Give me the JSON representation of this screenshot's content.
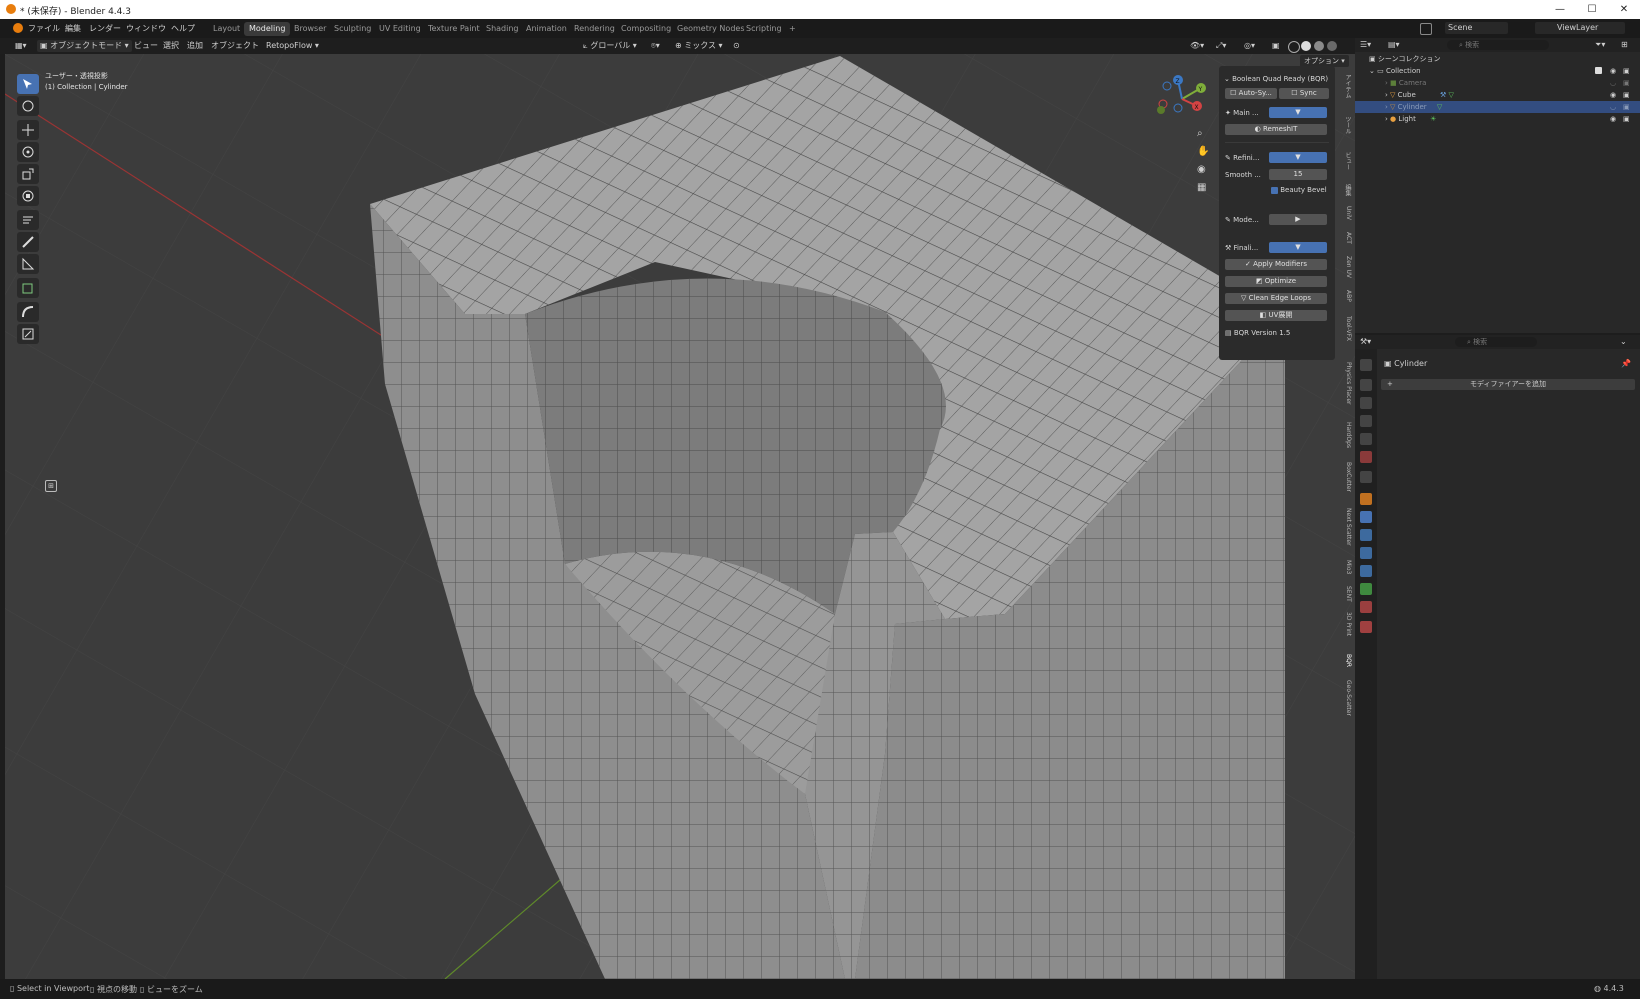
{
  "window": {
    "title": "* (未保存) - Blender 4.4.3",
    "minimize": "—",
    "maximize": "☐",
    "close": "✕"
  },
  "menu": [
    "ファイル",
    "編集",
    "レンダー",
    "ウィンドウ",
    "ヘルプ"
  ],
  "workspaces": [
    "Layout",
    "Modeling",
    "Browser",
    "Sculpting",
    "UV Editing",
    "Texture Paint",
    "Shading",
    "Animation",
    "Rendering",
    "Compositing",
    "Geometry Nodes",
    "Scripting",
    "+"
  ],
  "active_workspace": "Modeling",
  "header": {
    "mode": "オブジェクトモード",
    "view": "ビュー",
    "select": "選択",
    "add": "追加",
    "object": "オブジェクト",
    "addon": "RetopoFlow",
    "transform": "グローバル",
    "snap": "ミックス",
    "options": "オプション"
  },
  "viewport": {
    "line1": "ユーザー・透視投影",
    "line2": "(1) Collection | Cylinder",
    "gizmo": {
      "x": "X",
      "y": "Y",
      "z": "Z"
    }
  },
  "bqr_panel": {
    "title": "Boolean Quad Ready (BQR)",
    "auto_sync": "Auto-Sy...",
    "sync": "Sync",
    "main": "Main ...",
    "remeshit": "RemeshIT",
    "refine": "Refini...",
    "smooth": "Smooth ...",
    "smooth_value": "15",
    "beauty_bevel": "Beauty Bevel",
    "modifiers": "Mode...",
    "finalize": "Finali...",
    "apply_modifiers": "Apply Modifiers",
    "optimize": "Optimize",
    "clean_edge_loops": "Clean Edge Loops",
    "uv": "UV展開",
    "version": "BQR Version 1.5"
  },
  "side_tabs": [
    "アイテム",
    "ツール",
    "ビュー",
    "編集",
    "UniV",
    "ACT",
    "Zen UV",
    "ABP",
    "Tool-VFX",
    "Physics Placer",
    "HardOps",
    "BoxCutter",
    "Next Scatter",
    "Mio3",
    "SENT",
    "3D Print",
    "BQR",
    "Geo-Scatter"
  ],
  "outliner": {
    "search_placeholder": "検索",
    "scene_collection": "シーンコレクション",
    "collection": "Collection",
    "items": [
      {
        "name": "Camera",
        "dim": true
      },
      {
        "name": "Cube",
        "dim": false
      },
      {
        "name": "Cylinder",
        "dim": true,
        "selected": true
      },
      {
        "name": "Light",
        "dim": false
      }
    ]
  },
  "top_right": {
    "scene": "Scene",
    "view_layer": "ViewLayer"
  },
  "properties": {
    "search_placeholder": "検索",
    "object": "Cylinder",
    "add_modifier": "モディファイアーを追加"
  },
  "status": {
    "select": "Select in Viewport",
    "move": "視点の移動",
    "zoom": "ビューをズーム",
    "version": "4.4.3"
  },
  "colors": {
    "accent": "#4772b3",
    "viewport_bg": "#3c3c3c",
    "mesh": "#9a9a9a"
  }
}
